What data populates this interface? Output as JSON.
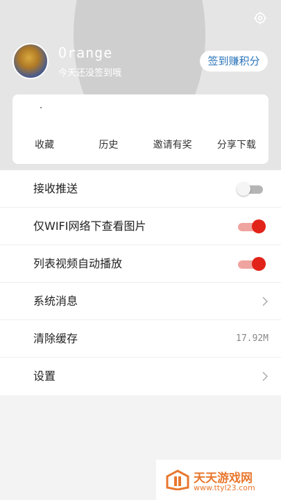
{
  "header": {
    "username": "Orange",
    "subtitle": "今天还没签到哦",
    "signin_button": "签到赚积分"
  },
  "actions": [
    "收藏",
    "历史",
    "邀请有奖",
    "分享下载"
  ],
  "settings": {
    "push": {
      "label": "接收推送",
      "enabled": false
    },
    "wifi_images": {
      "label": "仅WIFI网络下查看图片",
      "enabled": true
    },
    "autoplay": {
      "label": "列表视频自动播放",
      "enabled": true
    },
    "messages": {
      "label": "系统消息"
    },
    "cache": {
      "label": "清除缓存",
      "value": "17.92M"
    },
    "settings": {
      "label": "设置"
    }
  },
  "watermark": {
    "title": "天天游戏网",
    "url": "www.ttyl23.com"
  },
  "colors": {
    "accent": "#e2231a",
    "link": "#2a74b8",
    "watermark": "#e8772e"
  }
}
